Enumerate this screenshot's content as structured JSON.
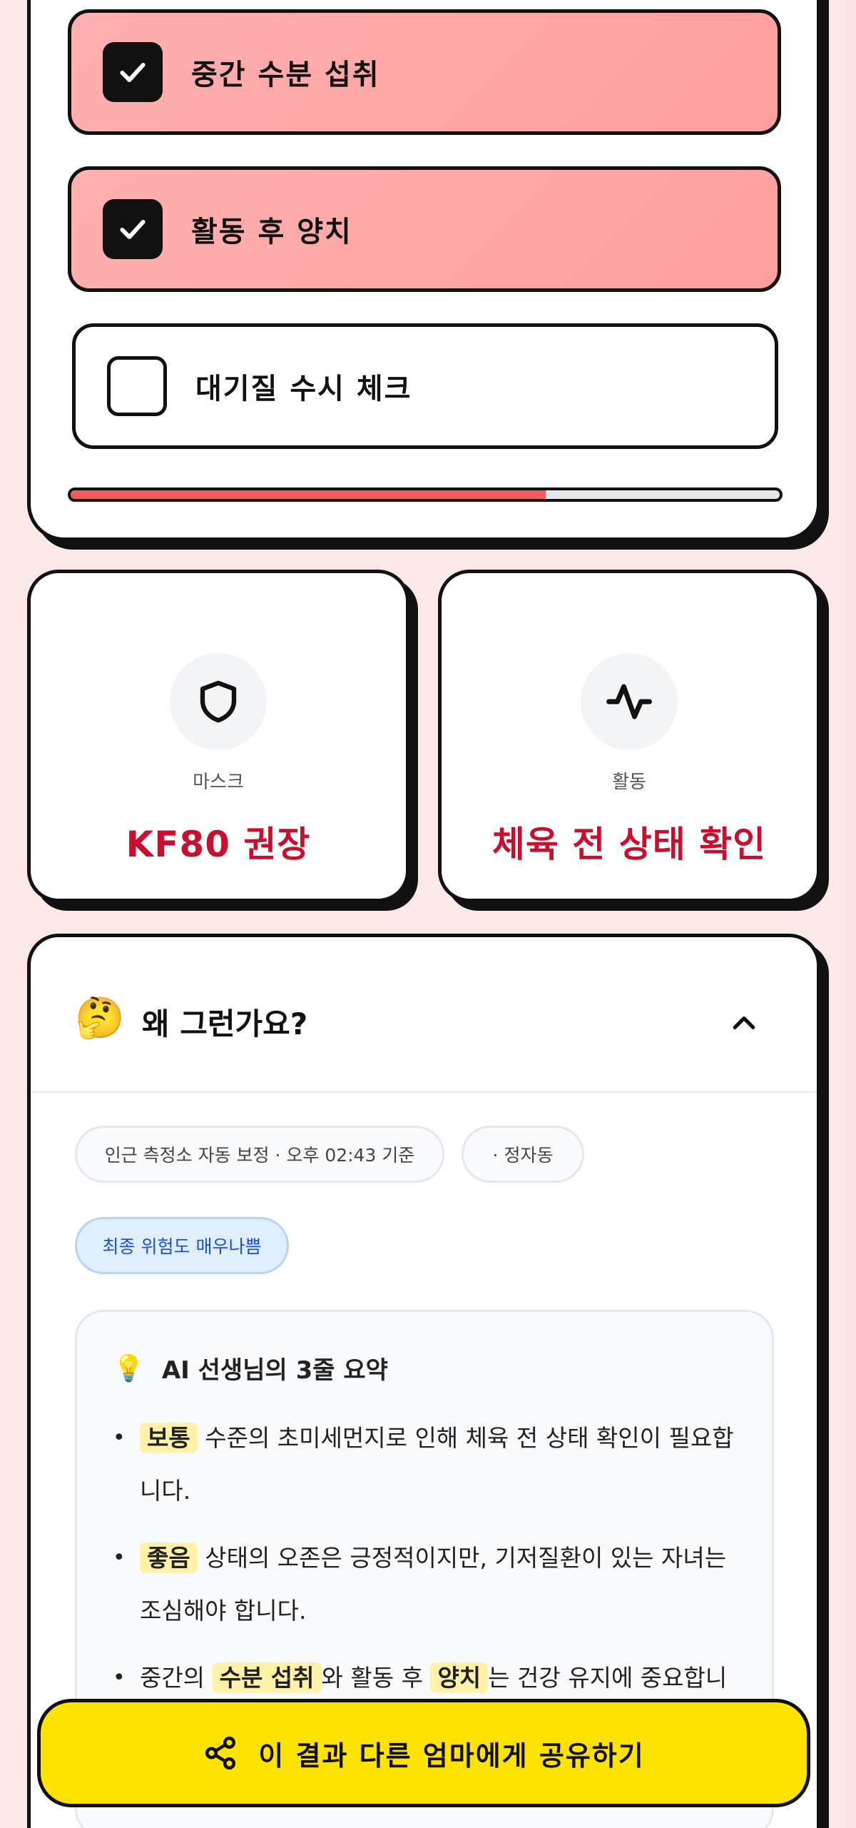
{
  "checklist": {
    "items": [
      {
        "label": "중간 수분 섭취",
        "checked": true
      },
      {
        "label": "활동 후 양치",
        "checked": true
      },
      {
        "label": "대기질 수시 체크",
        "checked": false
      }
    ],
    "progress_fraction": 0.67,
    "colors": {
      "checked_bg": "#ffa3a3",
      "progress": "#f25c5c"
    }
  },
  "stats": {
    "mask": {
      "icon": "shield-icon",
      "label": "마스크",
      "value": "KF80 권장"
    },
    "activity": {
      "icon": "activity-pulse-icon",
      "label": "활동",
      "value": "체육 전 상태 확인"
    },
    "value_color": "#c8102e"
  },
  "why": {
    "emoji": "🤔",
    "title": "왜 그런가요?",
    "chips": {
      "source": "인근 측정소 자동 보정 · 오후 02:43 기준",
      "location": "· 정자동",
      "risk": "최종 위험도 매우나쁨"
    },
    "ai_summary": {
      "bulb": "💡",
      "title": "AI 선생님의 3줄 요약",
      "items": [
        {
          "pre": "",
          "hl1": "보통",
          "mid": " 수준의 초미세먼지로 인해 체육 전 상태 확인이 필요합니다.",
          "hl2": "",
          "post": ""
        },
        {
          "pre": "",
          "hl1": "좋음",
          "mid": " 상태의 오존은 긍정적이지만, 기저질환이 있는 자녀는 조심해야 합니다.",
          "hl2": "",
          "post": ""
        },
        {
          "pre": "중간의 ",
          "hl1": "수분 섭취",
          "mid": "와 활동 후 ",
          "hl2": "양치",
          "post": "는 건강 유지에 중요합니다."
        }
      ]
    }
  },
  "share": {
    "label": "이 결과 다른 엄마에게 공유하기",
    "icon": "share-icon",
    "color": "#ffe300"
  }
}
